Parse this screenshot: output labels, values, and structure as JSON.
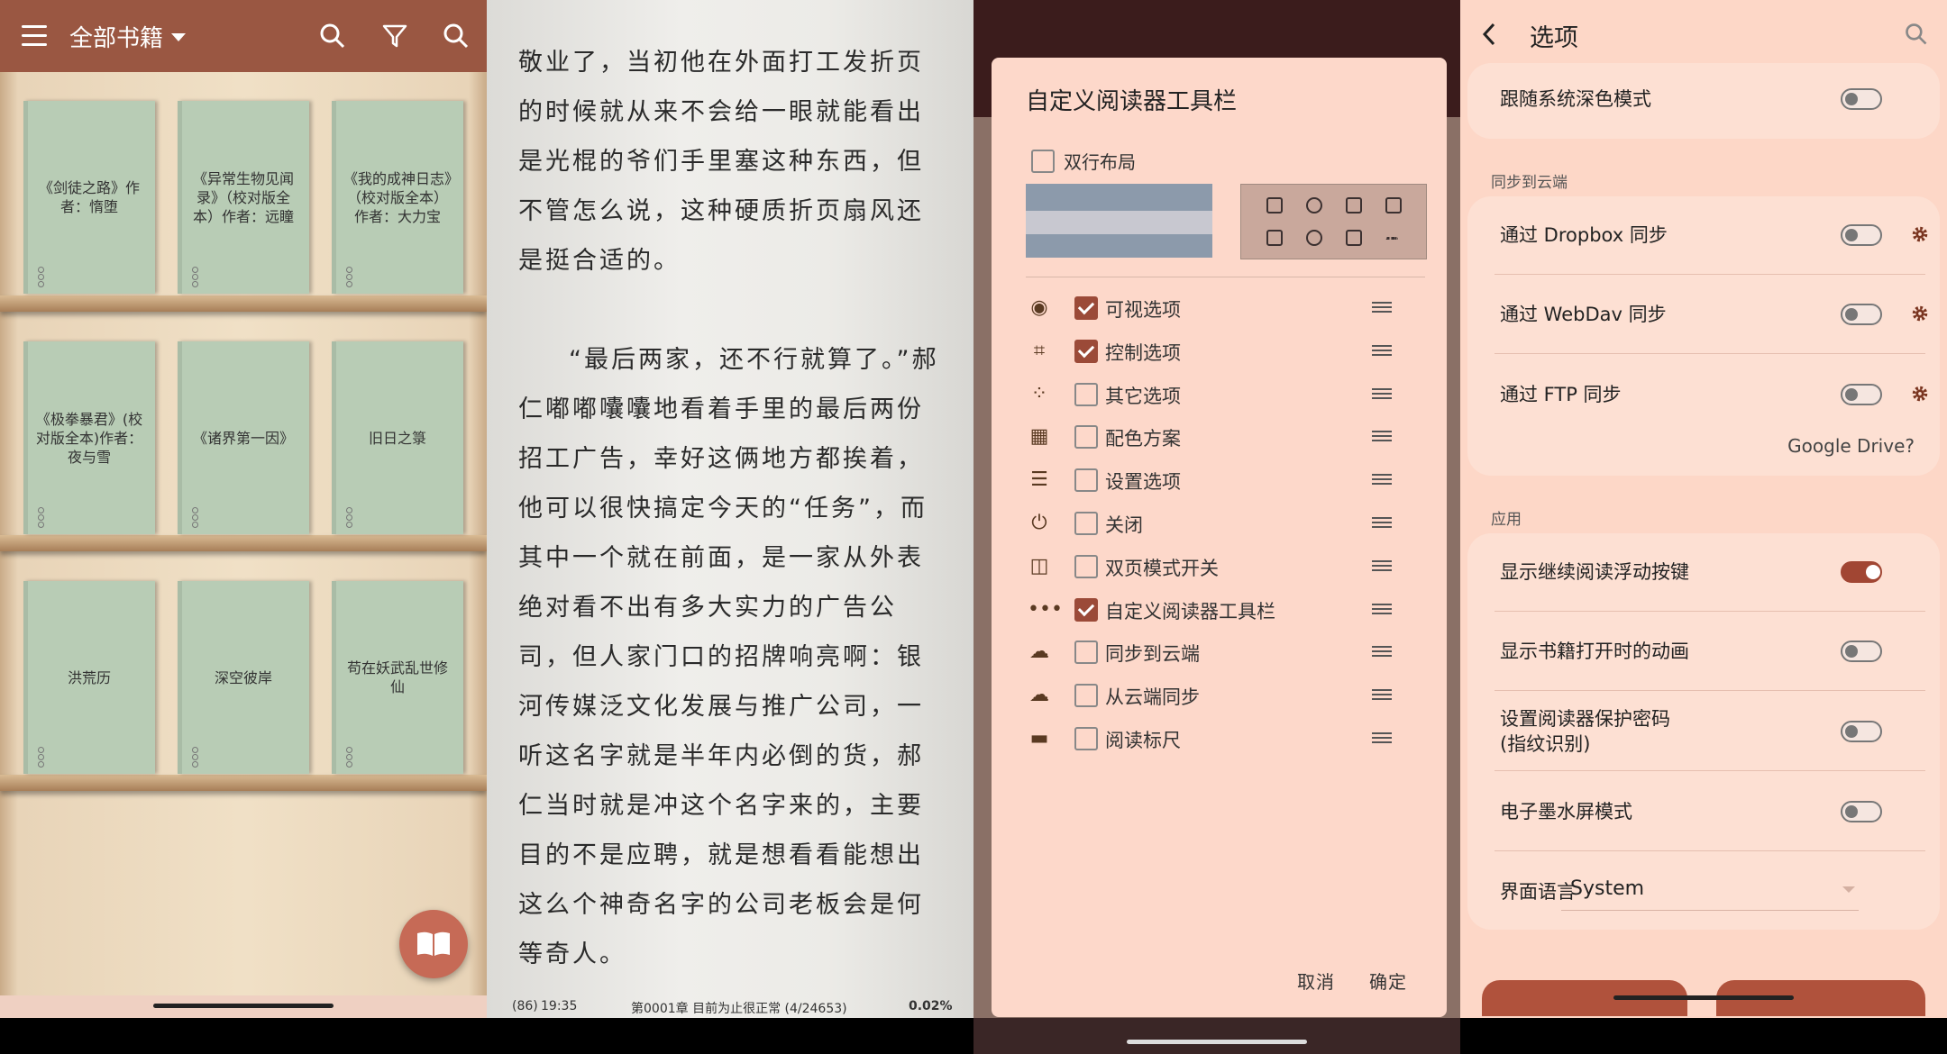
{
  "library": {
    "title": "全部书籍",
    "books": [
      {
        "title": "《剑徒之路》作者：惰堕"
      },
      {
        "title": "《异常生物见闻录》（校对版全本）作者：远瞳"
      },
      {
        "title": "《我的成神日志》（校对版全本）作者：大力宝"
      },
      {
        "title": "《极拳暴君》(校对版全本)作者：夜与雪"
      },
      {
        "title": "《诸界第一因》"
      },
      {
        "title": "旧日之箓"
      },
      {
        "title": "洪荒历"
      },
      {
        "title": "深空彼岸"
      },
      {
        "title": "苟在妖武乱世修仙"
      }
    ],
    "colors": {
      "toolbar": "#9a5742",
      "book_cover": "#b8ccb5",
      "fab": "#c66a56"
    }
  },
  "reader": {
    "paragraphs": [
      "敬业了，当初他在外面打工发折页的时候就从来不会给一眼就能看出是光棍的爷们手里塞这种东西，但不管怎么说，这种硬质折页扇风还是挺合适的。",
      "“最后两家，还不行就算了。”郝仁嘟嘟囔囔地看着手里的最后两份招工广告，幸好这俩地方都挨着，他可以很快搞定今天的“任务”，而其中一个就在前面，是一家从外表绝对看不出有多大实力的广告公司，但人家门口的招牌响亮啊：银河传媒泛文化发展与推广公司，一听这名字就是半年内必倒的货，郝仁当时就是冲这个名字来的，主要目的不是应聘，就是想看看能想出这么个神奇名字的公司老板会是何等奇人。"
    ],
    "status": {
      "battery": "86",
      "time": "19:35",
      "chapter": "第0001章 目前为止很正常 (4/24653)",
      "progress": "0.02%"
    }
  },
  "toolbar_dialog": {
    "title": "自定义阅读器工具栏",
    "two_line_label": "双行布局",
    "two_line_checked": false,
    "options": [
      {
        "icon": "eye-icon",
        "label": "可视选项",
        "checked": true
      },
      {
        "icon": "control-icon",
        "label": "控制选项",
        "checked": true
      },
      {
        "icon": "dots-grid-icon",
        "label": "其它选项",
        "checked": false
      },
      {
        "icon": "windows-icon",
        "label": "配色方案",
        "checked": false
      },
      {
        "icon": "settings-lines-icon",
        "label": "设置选项",
        "checked": false
      },
      {
        "icon": "power-icon",
        "label": "关闭",
        "checked": false
      },
      {
        "icon": "dual-page-icon",
        "label": "双页模式开关",
        "checked": false
      },
      {
        "icon": "more-icon",
        "label": "自定义阅读器工具栏",
        "checked": true
      },
      {
        "icon": "cloud-upload-icon",
        "label": "同步到云端",
        "checked": false
      },
      {
        "icon": "cloud-download-icon",
        "label": "从云端同步",
        "checked": false
      },
      {
        "icon": "ruler-icon",
        "label": "阅读标尺",
        "checked": false
      }
    ],
    "cancel": "取消",
    "ok": "确定"
  },
  "settings": {
    "title": "选项",
    "follow_dark": {
      "label": "跟随系统深色模式",
      "on": false
    },
    "sync_section": "同步到云端",
    "sync": [
      {
        "label": "通过 Dropbox 同步",
        "on": false
      },
      {
        "label": "通过 WebDav 同步",
        "on": false
      },
      {
        "label": "通过 FTP 同步",
        "on": false
      }
    ],
    "google_drive": "Google Drive?",
    "app_section": "应用",
    "app": [
      {
        "label": "显示继续阅读浮动按键",
        "on": true
      },
      {
        "label": "显示书籍打开时的动画",
        "on": false
      },
      {
        "label": "设置阅读器保护密码\n(指纹识别)",
        "on": false
      },
      {
        "label": "电子墨水屏模式",
        "on": false
      }
    ],
    "language_label": "界面语言",
    "language_value": "System",
    "accent": "#a14633"
  }
}
